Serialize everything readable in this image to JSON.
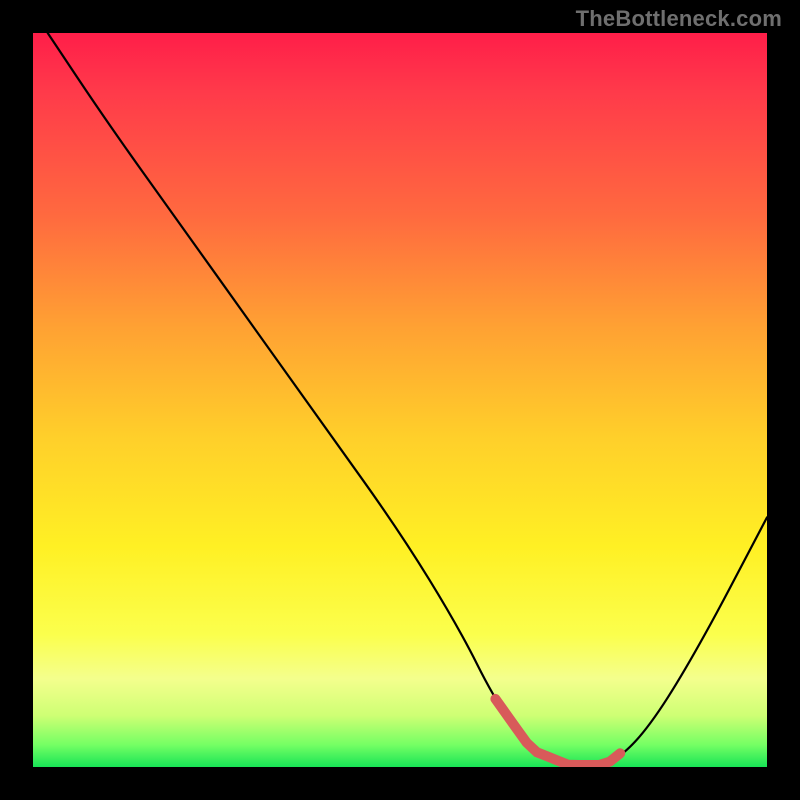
{
  "watermark": "TheBottleneck.com",
  "chart_data": {
    "type": "line",
    "title": "",
    "xlabel": "",
    "ylabel": "",
    "xlim": [
      0,
      100
    ],
    "ylim": [
      0,
      100
    ],
    "series": [
      {
        "name": "bottleneck-curve",
        "x": [
          2,
          10,
          20,
          30,
          40,
          50,
          58,
          63,
          68,
          73,
          78,
          83,
          90,
          100
        ],
        "values": [
          100,
          88,
          74,
          60,
          46,
          32,
          19,
          9,
          2,
          0,
          0,
          4,
          15,
          34
        ]
      }
    ],
    "highlight": {
      "name": "valley-highlight",
      "x0": 63,
      "x1": 80,
      "color": "#d85a5a"
    },
    "colors": {
      "gradient_top": "#ff1e49",
      "gradient_mid": "#ffe22a",
      "gradient_bottom": "#18e456",
      "curve": "#000000",
      "accent": "#d85a5a",
      "background": "#000000",
      "watermark": "#6f6f6f"
    }
  }
}
